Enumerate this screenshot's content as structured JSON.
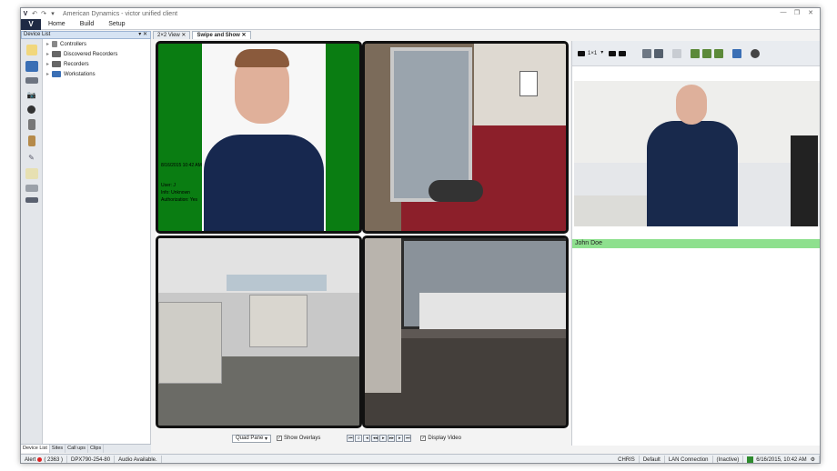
{
  "window": {
    "title": "American Dynamics - victor unified client"
  },
  "menu": {
    "logo": "V",
    "items": [
      "Home",
      "Build",
      "Setup"
    ]
  },
  "device_panel": {
    "title": "Device List",
    "pin": "▾ ✕",
    "tree": [
      "Controllers",
      "Discovered Recorders",
      "Recorders",
      "Workstations"
    ]
  },
  "tabs": [
    "2×2 View",
    "Swipe and Show"
  ],
  "bottom_tabs": [
    "Device List",
    "Sites",
    "Call ups",
    "Clips"
  ],
  "quad_controls": {
    "layout_select": "Quad Pane",
    "show_overlays": "Show Overlays",
    "display_video": "Display Video"
  },
  "overlay_text": {
    "line1": "8/16/2015 10:42 AM",
    "line2": "User: J",
    "line3": "Info: Unknown",
    "line4": "Authorization: Yes"
  },
  "right_panel": {
    "layout_label": "1×1",
    "card_name": "John Doe"
  },
  "status": {
    "alert_label": "Alert",
    "alert_count": "( 2363 )",
    "device": "DPX790-254-80",
    "audio": "Audio Available.",
    "site": "CHRIS",
    "profile": "Default",
    "connection": "LAN Connection",
    "state": "(Inactive)",
    "datetime": "6/16/2015, 10:42 AM"
  },
  "colors": {
    "badge_green": "#0a7d12",
    "name_bar": "#8ee08e",
    "brand": "#1f2a44"
  }
}
